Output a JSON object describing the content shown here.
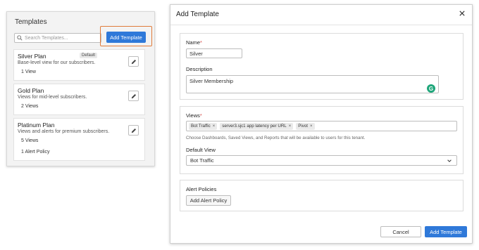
{
  "templates_panel": {
    "title": "Templates",
    "search_placeholder": "Search Templates...",
    "add_button": "Add Template",
    "cards": [
      {
        "name": "Silver Plan",
        "badge": "Default",
        "description": "Base-level view for our subscribers.",
        "meta": [
          "1 View"
        ]
      },
      {
        "name": "Gold Plan",
        "badge": "",
        "description": "Views for mid-level subscribers.",
        "meta": [
          "2 Views"
        ]
      },
      {
        "name": "Platinum Plan",
        "badge": "",
        "description": "Views and alerts for premium subscribers.",
        "meta": [
          "5 Views",
          "1 Alert Policy"
        ]
      }
    ]
  },
  "modal": {
    "title": "Add Template",
    "close_icon": "close-icon",
    "name_label": "Name",
    "required_mark": "*",
    "name_value": "Silver",
    "description_label": "Description",
    "description_value": "Silver Membership",
    "grammarly_letter": "G",
    "views_label": "Views",
    "views_chips": [
      "Bot Traffic",
      "server3.sjc1 app latency per URL",
      "Pivot"
    ],
    "chip_remove": "×",
    "views_help": "Choose Dashboards, Saved Views, and Reports that will be available to users for this tenant.",
    "default_view_label": "Default View",
    "default_view_value": "Bot Traffic",
    "alert_policies_label": "Alert Policies",
    "add_alert_policy_button": "Add Alert Policy",
    "cancel_button": "Cancel",
    "submit_button": "Add Template"
  },
  "colors": {
    "primary": "#2f79d9",
    "highlight": "#e07b3a",
    "required": "#d9534f",
    "grammarly": "#1fa67a"
  }
}
